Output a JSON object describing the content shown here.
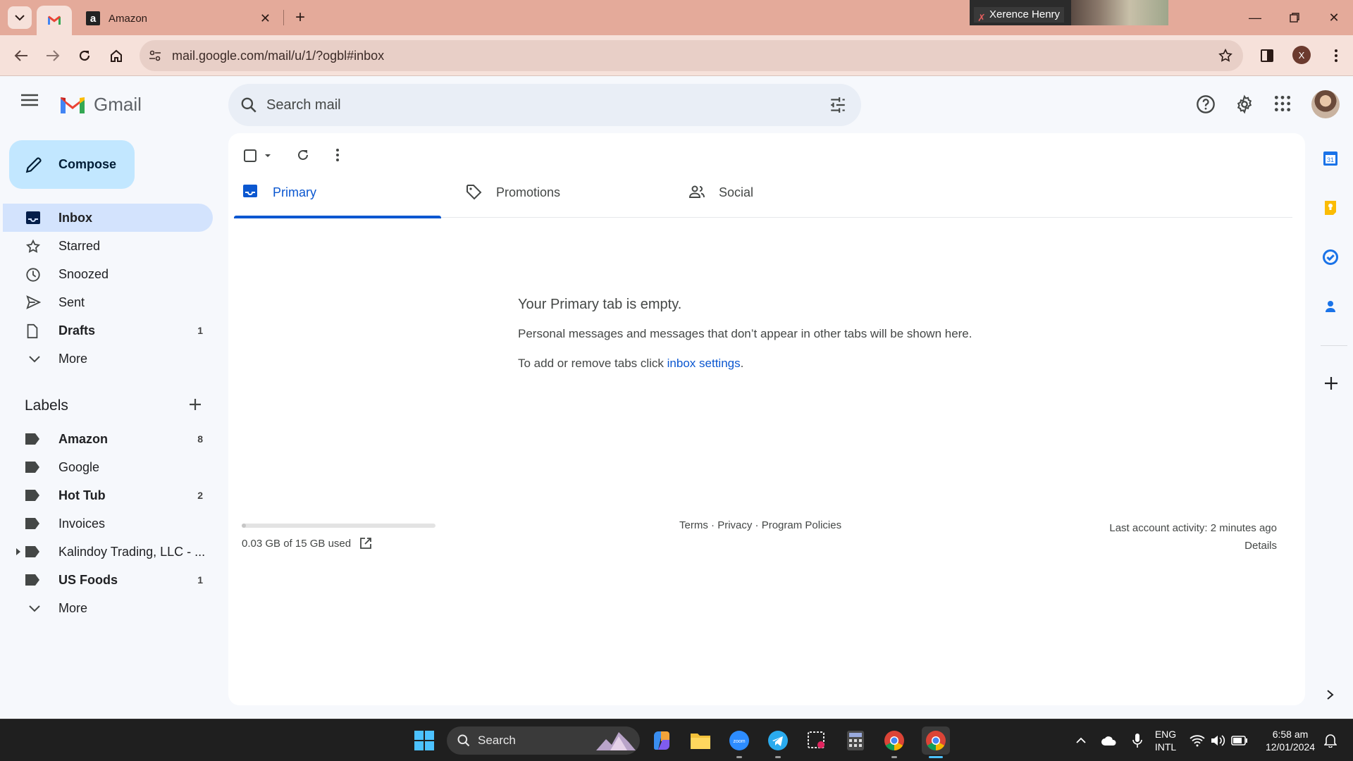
{
  "browser": {
    "tabs": [
      {
        "label": "Amazon",
        "favicon": "amazon-icon"
      }
    ],
    "active_tab_favicon": "gmail-icon",
    "url": "mail.google.com/mail/u/1/?ogbl#inbox",
    "profile_initial": "X",
    "meet_pip_name": "Xerence Henry"
  },
  "gmail": {
    "brand": "Gmail",
    "search_placeholder": "Search mail",
    "compose_label": "Compose",
    "nav": [
      {
        "label": "Inbox",
        "count": "",
        "icon": "inbox-icon"
      },
      {
        "label": "Starred",
        "count": "",
        "icon": "star-icon"
      },
      {
        "label": "Snoozed",
        "count": "",
        "icon": "clock-icon"
      },
      {
        "label": "Sent",
        "count": "",
        "icon": "send-icon"
      },
      {
        "label": "Drafts",
        "count": "1",
        "icon": "draft-icon"
      },
      {
        "label": "More",
        "count": "",
        "icon": "chevron-down-icon"
      }
    ],
    "labels_heading": "Labels",
    "labels": [
      {
        "label": "Amazon",
        "count": "8"
      },
      {
        "label": "Google",
        "count": ""
      },
      {
        "label": "Hot Tub",
        "count": "2"
      },
      {
        "label": "Invoices",
        "count": ""
      },
      {
        "label": "Kalindoy Trading, LLC - ...",
        "count": ""
      },
      {
        "label": "US Foods",
        "count": "1"
      }
    ],
    "labels_more": "More",
    "tabs": [
      {
        "label": "Primary",
        "icon": "inbox-tab-icon"
      },
      {
        "label": "Promotions",
        "icon": "tag-icon"
      },
      {
        "label": "Social",
        "icon": "people-icon"
      }
    ],
    "empty": {
      "title": "Your Primary tab is empty.",
      "description": "Personal messages and messages that don’t appear in other tabs will be shown here.",
      "hint_prefix": "To add or remove tabs click ",
      "hint_link": "inbox settings",
      "hint_suffix": "."
    },
    "storage": {
      "text": "0.03 GB of 15 GB used",
      "used_fraction": 0.002
    },
    "footer": {
      "terms": "Terms",
      "privacy": "Privacy",
      "policies": "Program Policies",
      "sep": " · "
    },
    "activity": {
      "text": "Last account activity: 2 minutes ago",
      "details": "Details"
    },
    "calendar_day": "31"
  },
  "taskbar": {
    "search_label": "Search",
    "lang_1": "ENG",
    "lang_2": "INTL",
    "time": "6:58 am",
    "date": "12/01/2024"
  },
  "colors": {
    "accent": "#0b57d0",
    "compose": "#c2e7ff",
    "active_nav": "#d3e3fd",
    "titlebar": "#e4aa9a"
  }
}
